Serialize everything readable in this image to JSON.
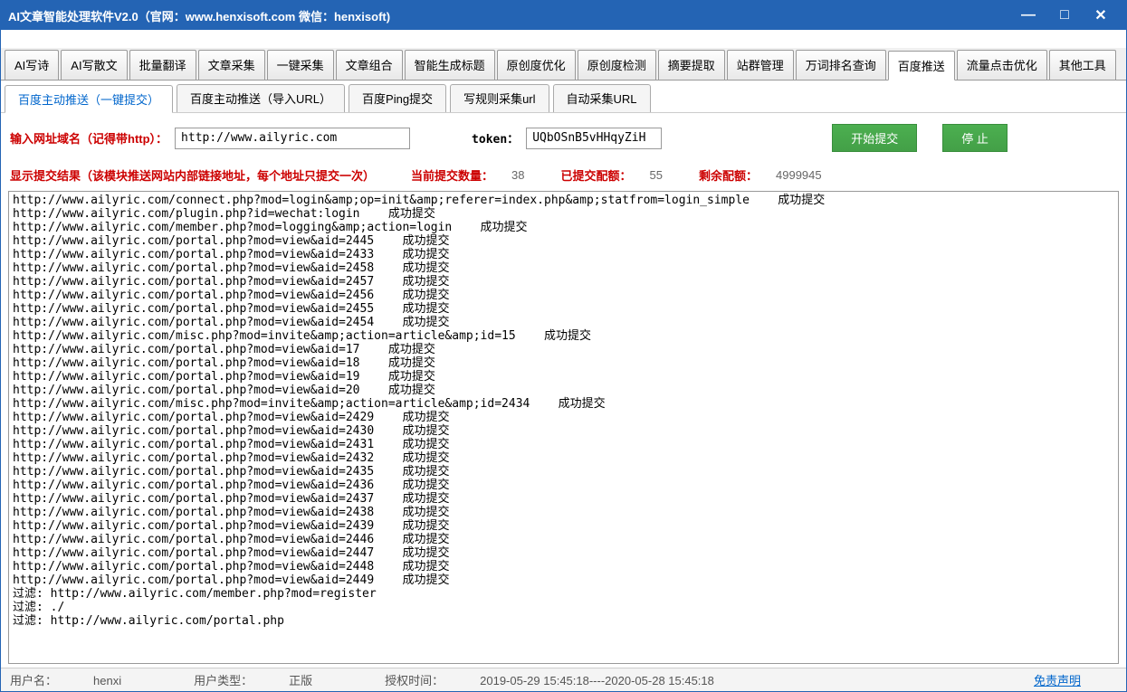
{
  "title": "AI文章智能处理软件V2.0（官网：www.henxisoft.com 微信：henxisoft)",
  "main_tabs": [
    "AI写诗",
    "AI写散文",
    "批量翻译",
    "文章采集",
    "一键采集",
    "文章组合",
    "智能生成标题",
    "原创度优化",
    "原创度检测",
    "摘要提取",
    "站群管理",
    "万词排名查询",
    "百度推送",
    "流量点击优化",
    "其他工具"
  ],
  "main_tab_active": 12,
  "sub_tabs": [
    "百度主动推送（一键提交）",
    "百度主动推送（导入URL）",
    "百度Ping提交",
    "写规则采集url",
    "自动采集URL"
  ],
  "sub_tab_active": 0,
  "input": {
    "url_label": "输入网址域名（记得带http）：",
    "url_value": "http://www.ailyric.com",
    "token_label": "token：",
    "token_value": "UQbOSnB5vHHqyZiH",
    "start_btn": "开始提交",
    "stop_btn": "停 止"
  },
  "status": {
    "result_label": "显示提交结果（该模块推送网站内部链接地址，每个地址只提交一次）",
    "current_label": "当前提交数量：",
    "current_value": "38",
    "submitted_label": "已提交配额：",
    "submitted_value": "55",
    "remain_label": "剩余配额：",
    "remain_value": "4999945"
  },
  "log_lines": [
    "http://www.ailyric.com/connect.php?mod=login&amp;op=init&amp;referer=index.php&amp;statfrom=login_simple    成功提交",
    "http://www.ailyric.com/plugin.php?id=wechat:login    成功提交",
    "http://www.ailyric.com/member.php?mod=logging&amp;action=login    成功提交",
    "http://www.ailyric.com/portal.php?mod=view&aid=2445    成功提交",
    "http://www.ailyric.com/portal.php?mod=view&aid=2433    成功提交",
    "http://www.ailyric.com/portal.php?mod=view&aid=2458    成功提交",
    "http://www.ailyric.com/portal.php?mod=view&aid=2457    成功提交",
    "http://www.ailyric.com/portal.php?mod=view&aid=2456    成功提交",
    "http://www.ailyric.com/portal.php?mod=view&aid=2455    成功提交",
    "http://www.ailyric.com/portal.php?mod=view&aid=2454    成功提交",
    "http://www.ailyric.com/misc.php?mod=invite&amp;action=article&amp;id=15    成功提交",
    "http://www.ailyric.com/portal.php?mod=view&aid=17    成功提交",
    "http://www.ailyric.com/portal.php?mod=view&aid=18    成功提交",
    "http://www.ailyric.com/portal.php?mod=view&aid=19    成功提交",
    "http://www.ailyric.com/portal.php?mod=view&aid=20    成功提交",
    "http://www.ailyric.com/misc.php?mod=invite&amp;action=article&amp;id=2434    成功提交",
    "http://www.ailyric.com/portal.php?mod=view&aid=2429    成功提交",
    "http://www.ailyric.com/portal.php?mod=view&aid=2430    成功提交",
    "http://www.ailyric.com/portal.php?mod=view&aid=2431    成功提交",
    "http://www.ailyric.com/portal.php?mod=view&aid=2432    成功提交",
    "http://www.ailyric.com/portal.php?mod=view&aid=2435    成功提交",
    "http://www.ailyric.com/portal.php?mod=view&aid=2436    成功提交",
    "http://www.ailyric.com/portal.php?mod=view&aid=2437    成功提交",
    "http://www.ailyric.com/portal.php?mod=view&aid=2438    成功提交",
    "http://www.ailyric.com/portal.php?mod=view&aid=2439    成功提交",
    "http://www.ailyric.com/portal.php?mod=view&aid=2446    成功提交",
    "http://www.ailyric.com/portal.php?mod=view&aid=2447    成功提交",
    "http://www.ailyric.com/portal.php?mod=view&aid=2448    成功提交",
    "http://www.ailyric.com/portal.php?mod=view&aid=2449    成功提交",
    "",
    "过滤: http://www.ailyric.com/member.php?mod=register",
    "过滤: ./",
    "过滤: http://www.ailyric.com/portal.php"
  ],
  "statusbar": {
    "user_label": "用户名：",
    "user_value": "henxi",
    "type_label": "用户类型：",
    "type_value": "正版",
    "auth_label": "授权时间：",
    "auth_value": "2019-05-29 15:45:18----2020-05-28 15:45:18",
    "disclaimer": "免责声明"
  }
}
